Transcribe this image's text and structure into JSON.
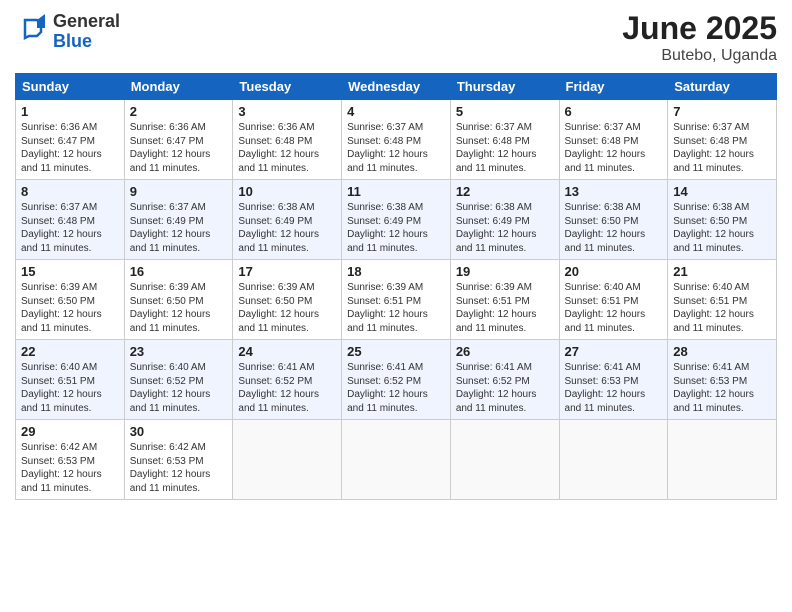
{
  "logo": {
    "general": "General",
    "blue": "Blue"
  },
  "title": "June 2025",
  "subtitle": "Butebo, Uganda",
  "days_of_week": [
    "Sunday",
    "Monday",
    "Tuesday",
    "Wednesday",
    "Thursday",
    "Friday",
    "Saturday"
  ],
  "weeks": [
    [
      {
        "day": "1",
        "lines": [
          "Sunrise: 6:36 AM",
          "Sunset: 6:47 PM",
          "Daylight: 12 hours",
          "and 11 minutes."
        ]
      },
      {
        "day": "2",
        "lines": [
          "Sunrise: 6:36 AM",
          "Sunset: 6:47 PM",
          "Daylight: 12 hours",
          "and 11 minutes."
        ]
      },
      {
        "day": "3",
        "lines": [
          "Sunrise: 6:36 AM",
          "Sunset: 6:48 PM",
          "Daylight: 12 hours",
          "and 11 minutes."
        ]
      },
      {
        "day": "4",
        "lines": [
          "Sunrise: 6:37 AM",
          "Sunset: 6:48 PM",
          "Daylight: 12 hours",
          "and 11 minutes."
        ]
      },
      {
        "day": "5",
        "lines": [
          "Sunrise: 6:37 AM",
          "Sunset: 6:48 PM",
          "Daylight: 12 hours",
          "and 11 minutes."
        ]
      },
      {
        "day": "6",
        "lines": [
          "Sunrise: 6:37 AM",
          "Sunset: 6:48 PM",
          "Daylight: 12 hours",
          "and 11 minutes."
        ]
      },
      {
        "day": "7",
        "lines": [
          "Sunrise: 6:37 AM",
          "Sunset: 6:48 PM",
          "Daylight: 12 hours",
          "and 11 minutes."
        ]
      }
    ],
    [
      {
        "day": "8",
        "lines": [
          "Sunrise: 6:37 AM",
          "Sunset: 6:48 PM",
          "Daylight: 12 hours",
          "and 11 minutes."
        ]
      },
      {
        "day": "9",
        "lines": [
          "Sunrise: 6:37 AM",
          "Sunset: 6:49 PM",
          "Daylight: 12 hours",
          "and 11 minutes."
        ]
      },
      {
        "day": "10",
        "lines": [
          "Sunrise: 6:38 AM",
          "Sunset: 6:49 PM",
          "Daylight: 12 hours",
          "and 11 minutes."
        ]
      },
      {
        "day": "11",
        "lines": [
          "Sunrise: 6:38 AM",
          "Sunset: 6:49 PM",
          "Daylight: 12 hours",
          "and 11 minutes."
        ]
      },
      {
        "day": "12",
        "lines": [
          "Sunrise: 6:38 AM",
          "Sunset: 6:49 PM",
          "Daylight: 12 hours",
          "and 11 minutes."
        ]
      },
      {
        "day": "13",
        "lines": [
          "Sunrise: 6:38 AM",
          "Sunset: 6:50 PM",
          "Daylight: 12 hours",
          "and 11 minutes."
        ]
      },
      {
        "day": "14",
        "lines": [
          "Sunrise: 6:38 AM",
          "Sunset: 6:50 PM",
          "Daylight: 12 hours",
          "and 11 minutes."
        ]
      }
    ],
    [
      {
        "day": "15",
        "lines": [
          "Sunrise: 6:39 AM",
          "Sunset: 6:50 PM",
          "Daylight: 12 hours",
          "and 11 minutes."
        ]
      },
      {
        "day": "16",
        "lines": [
          "Sunrise: 6:39 AM",
          "Sunset: 6:50 PM",
          "Daylight: 12 hours",
          "and 11 minutes."
        ]
      },
      {
        "day": "17",
        "lines": [
          "Sunrise: 6:39 AM",
          "Sunset: 6:50 PM",
          "Daylight: 12 hours",
          "and 11 minutes."
        ]
      },
      {
        "day": "18",
        "lines": [
          "Sunrise: 6:39 AM",
          "Sunset: 6:51 PM",
          "Daylight: 12 hours",
          "and 11 minutes."
        ]
      },
      {
        "day": "19",
        "lines": [
          "Sunrise: 6:39 AM",
          "Sunset: 6:51 PM",
          "Daylight: 12 hours",
          "and 11 minutes."
        ]
      },
      {
        "day": "20",
        "lines": [
          "Sunrise: 6:40 AM",
          "Sunset: 6:51 PM",
          "Daylight: 12 hours",
          "and 11 minutes."
        ]
      },
      {
        "day": "21",
        "lines": [
          "Sunrise: 6:40 AM",
          "Sunset: 6:51 PM",
          "Daylight: 12 hours",
          "and 11 minutes."
        ]
      }
    ],
    [
      {
        "day": "22",
        "lines": [
          "Sunrise: 6:40 AM",
          "Sunset: 6:51 PM",
          "Daylight: 12 hours",
          "and 11 minutes."
        ]
      },
      {
        "day": "23",
        "lines": [
          "Sunrise: 6:40 AM",
          "Sunset: 6:52 PM",
          "Daylight: 12 hours",
          "and 11 minutes."
        ]
      },
      {
        "day": "24",
        "lines": [
          "Sunrise: 6:41 AM",
          "Sunset: 6:52 PM",
          "Daylight: 12 hours",
          "and 11 minutes."
        ]
      },
      {
        "day": "25",
        "lines": [
          "Sunrise: 6:41 AM",
          "Sunset: 6:52 PM",
          "Daylight: 12 hours",
          "and 11 minutes."
        ]
      },
      {
        "day": "26",
        "lines": [
          "Sunrise: 6:41 AM",
          "Sunset: 6:52 PM",
          "Daylight: 12 hours",
          "and 11 minutes."
        ]
      },
      {
        "day": "27",
        "lines": [
          "Sunrise: 6:41 AM",
          "Sunset: 6:53 PM",
          "Daylight: 12 hours",
          "and 11 minutes."
        ]
      },
      {
        "day": "28",
        "lines": [
          "Sunrise: 6:41 AM",
          "Sunset: 6:53 PM",
          "Daylight: 12 hours",
          "and 11 minutes."
        ]
      }
    ],
    [
      {
        "day": "29",
        "lines": [
          "Sunrise: 6:42 AM",
          "Sunset: 6:53 PM",
          "Daylight: 12 hours",
          "and 11 minutes."
        ]
      },
      {
        "day": "30",
        "lines": [
          "Sunrise: 6:42 AM",
          "Sunset: 6:53 PM",
          "Daylight: 12 hours",
          "and 11 minutes."
        ]
      },
      {
        "day": "",
        "lines": []
      },
      {
        "day": "",
        "lines": []
      },
      {
        "day": "",
        "lines": []
      },
      {
        "day": "",
        "lines": []
      },
      {
        "day": "",
        "lines": []
      }
    ]
  ]
}
